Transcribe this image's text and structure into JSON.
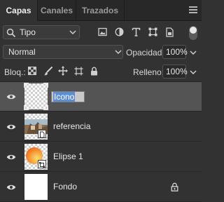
{
  "tabs": [
    {
      "label": "Capas",
      "active": true
    },
    {
      "label": "Canales",
      "active": false
    },
    {
      "label": "Trazados",
      "active": false
    }
  ],
  "filter": {
    "label": "Tipo"
  },
  "blend": {
    "mode": "Normal",
    "opacity_label": "Opacidad:",
    "opacity_value": "100%"
  },
  "lock": {
    "label": "Bloq.:",
    "fill_label": "Relleno:",
    "fill_value": "100%"
  },
  "layers": [
    {
      "name": "Icono",
      "selected": true,
      "editing": true,
      "visible": true,
      "thumbnail": "transparent"
    },
    {
      "name": "referencia",
      "selected": false,
      "visible": true,
      "thumbnail": "photo",
      "badge": "document-icon"
    },
    {
      "name": "Elipse 1",
      "selected": false,
      "visible": true,
      "thumbnail": "orange-ellipse",
      "badge": "shape-icon"
    },
    {
      "name": "Fondo",
      "selected": false,
      "visible": true,
      "thumbnail": "white",
      "locked": true
    }
  ],
  "colors": {
    "panel": "#323232",
    "selected_row": "#545454",
    "ellipse_orange": "#f4891f",
    "ellipse_yellow": "#fde06a",
    "text_highlight": "#5d8ed3"
  }
}
